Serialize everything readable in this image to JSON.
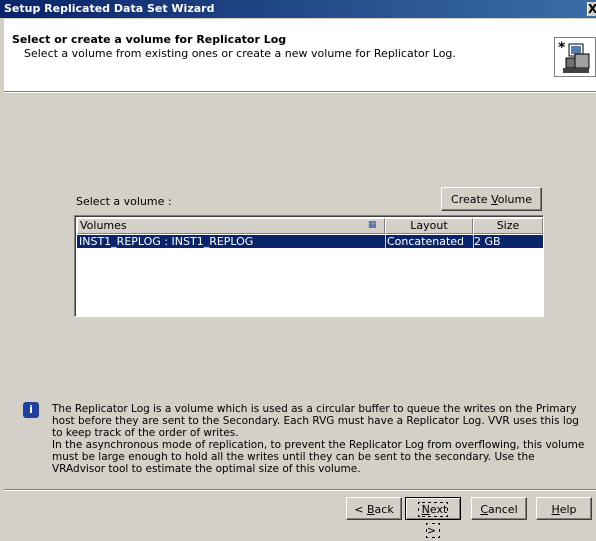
{
  "window": {
    "title": "Setup Replicated Data Set Wizard",
    "close_label": "X"
  },
  "header": {
    "title": "Select or create a volume for Replicator Log",
    "subtitle": "Select a volume from existing ones or create a new volume for Replicator Log.",
    "icon": "wizard-computer-icon"
  },
  "main": {
    "select_label": "Select a volume :",
    "create_volume_label": "Create Volume",
    "table": {
      "columns": [
        "Volumes",
        "Layout",
        "Size"
      ],
      "rows": [
        {
          "volume": "INST1_REPLOG : INST1_REPLOG",
          "layout": "Concatenated",
          "size": "2 GB",
          "selected": true
        }
      ]
    }
  },
  "info": {
    "icon": "info-icon",
    "line1": "The Replicator Log is a volume which is used as a circular buffer to queue the writes on the Primary host before they are sent to the Secondary. Each RVG must have a Replicator Log. VVR uses this log to keep track of the order of writes.",
    "line2": "In the asynchronous mode of replication, to prevent the Replicator Log from overflowing, this volume must be large enough to hold all the writes until they can be sent to the secondary. Use the VRAdvisor tool to estimate the optimal size of this volume."
  },
  "footer": {
    "back_label": "< Back",
    "next_label": "Next >",
    "cancel_label": "Cancel",
    "help_label": "Help"
  },
  "colors": {
    "title_bar": "#0a246a",
    "selection": "#0a246a",
    "dialog_bg": "#d4d0c8"
  }
}
